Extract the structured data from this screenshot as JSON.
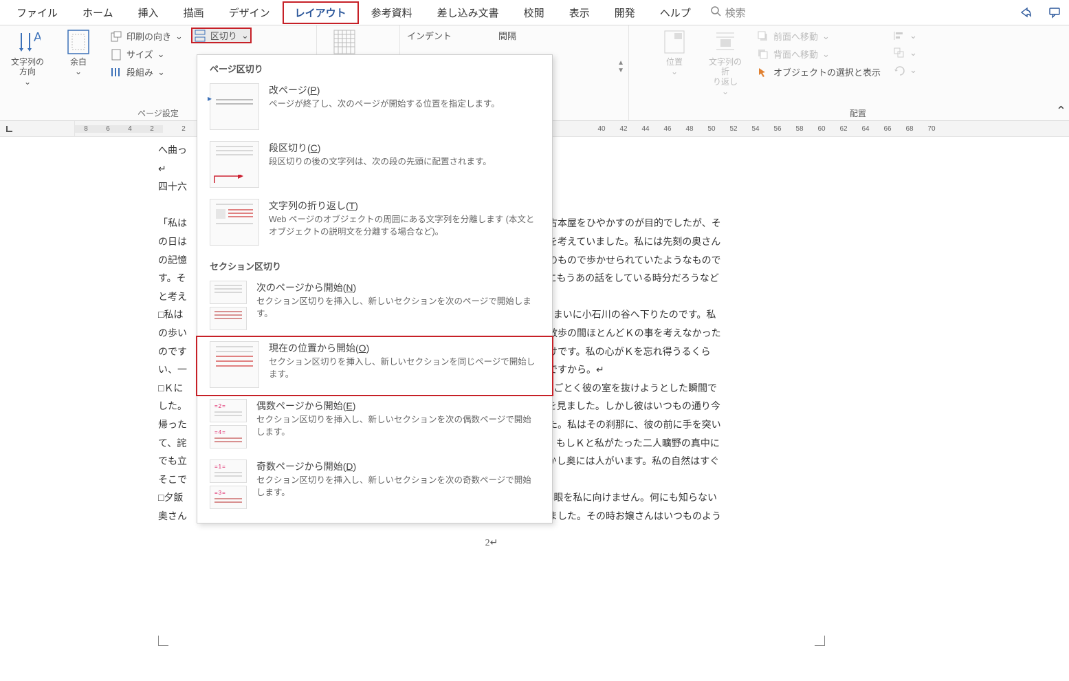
{
  "tabs": {
    "file": "ファイル",
    "home": "ホーム",
    "insert": "挿入",
    "draw": "描画",
    "design": "デザイン",
    "layout": "レイアウト",
    "references": "参考資料",
    "mailmerge": "差し込み文書",
    "review": "校閲",
    "view": "表示",
    "developer": "開発",
    "help": "ヘルプ",
    "search": "検索"
  },
  "ribbon": {
    "text_dir": "文字列の\n方向",
    "margins": "余白",
    "orientation": "印刷の向き",
    "size": "サイズ",
    "columns": "段組み",
    "breaks": "区切り",
    "page_setup_label": "ページ設定",
    "indent_hdr": "インデント",
    "spacing_hdr": "間隔",
    "position": "位置",
    "wrap": "文字列の折\nり返し",
    "bring_front": "前面へ移動",
    "send_back": "背面へ移動",
    "selection_pane": "オブジェクトの選択と表示",
    "arrange_label": "配置"
  },
  "ruler": {
    "left": [
      "8",
      "6",
      "4",
      "2"
    ],
    "right": [
      "2",
      "",
      "",
      "",
      "",
      "",
      "",
      "",
      "",
      "",
      "",
      "",
      "",
      "",
      "",
      "",
      "",
      "",
      "",
      "40",
      "42",
      "44",
      "46",
      "48",
      "50",
      "52",
      "54",
      "56",
      "58",
      "60",
      "62",
      "64",
      "66",
      "68",
      "70"
    ]
  },
  "dropdown": {
    "sec1": "ページ区切り",
    "items1": [
      {
        "title_pre": "改ページ(",
        "mn": "P",
        "title_post": ")",
        "desc": "ページが終了し、次のページが開始する位置を指定します。"
      },
      {
        "title_pre": "段区切り(",
        "mn": "C",
        "title_post": ")",
        "desc": "段区切りの後の文字列は、次の段の先頭に配置されます。"
      },
      {
        "title_pre": "文字列の折り返し(",
        "mn": "T",
        "title_post": ")",
        "desc": "Web ページのオブジェクトの周囲にある文字列を分離します (本文とオブジェクトの説明文を分離する場合など)。"
      }
    ],
    "sec2": "セクション区切り",
    "items2": [
      {
        "title_pre": "次のページから開始(",
        "mn": "N",
        "title_post": ")",
        "desc": "セクション区切りを挿入し、新しいセクションを次のページで開始します。",
        "nums": [
          "",
          "="
        ]
      },
      {
        "title_pre": "現在の位置から開始(",
        "mn": "O",
        "title_post": ")",
        "desc": "セクション区切りを挿入し、新しいセクションを同じページで開始します。",
        "highlight": true,
        "single": true
      },
      {
        "title_pre": "偶数ページから開始(",
        "mn": "E",
        "title_post": ")",
        "desc": "セクション区切りを挿入し、新しいセクションを次の偶数ページで開始します。",
        "nums": [
          "=2=",
          "=4="
        ]
      },
      {
        "title_pre": "奇数ページから開始(",
        "mn": "D",
        "title_post": ")",
        "desc": "セクション区切りを挿入し、新しいセクションを次の奇数ページで開始します。",
        "nums": [
          "=1=",
          "=3="
        ]
      }
    ]
  },
  "doc": {
    "lines": [
      "へ曲っ",
      "↵",
      "四十六",
      "",
      "「私は                                                                                                                          くのは、いつも古本屋をひやかすのが目的でしたが、そ",
      "の日は                                                                                                                          ら絶えず宅の事を考えていました。私には先刻の奥さん",
      "の記憶                                                                                                                          つまりこの二つのもので歩かせられていたようなもので",
      "す。そ                                                                                                                          さんがお嬢さんにもうあの話をしている時分だろうなど",
      "と考え",
      "□私は                                                                                                                          菊坂を下りて、しまいに小石川の谷へ下りたのです。私",
      "の歩い                                                                                                                          、私はこの長い散歩の間ほとんどＫの事を考えなかった",
      "のです                                                                                                                          不思議に思うだけです。私の心がＫを忘れ得うるくら",
      "い、一                                                                                                                          ずはなかったのですから。↵",
      "□Ｋに                                                                                                                          時、すなわち例のごとく彼の室を抜けようとした瞬間で",
      "した。                                                                                                                          眼を放して、私を見ました。しかし彼はいつもの通り今",
      "帰った                                                                                                                          か」と聞きました。私はその刹那に、彼の前に手を突い",
      "て、詫                                                                                                                          なかったのです。もしＫと私がたった二人曠野の真中に",
      "でも立                                                                                                                          と思います。しかし奥には人がいます。私の自然はすぐ",
      "そこで                                                                                                                          です。↵",
      "□夕飯                                                                                                                          、少しも疑い深い眼を私に向けません。何にも知らない",
      "奥さん                                                                                                                          ような飯を食いました。その時お嬢さんはいつものよう"
    ],
    "page_number": "2↵"
  }
}
